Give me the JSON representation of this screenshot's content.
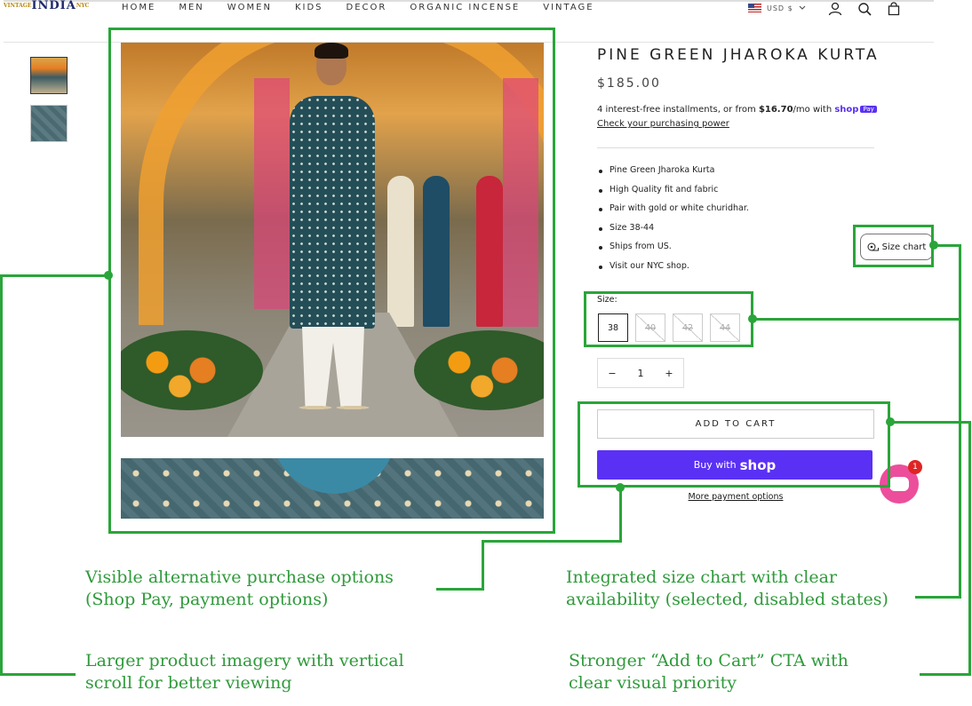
{
  "header": {
    "logo_text": "INDIA",
    "logo_small_left": "VINTAGE",
    "logo_small_right": "NYC",
    "nav": [
      "HOME",
      "MEN",
      "WOMEN",
      "KIDS",
      "DECOR",
      "ORGANIC INCENSE",
      "VINTAGE"
    ],
    "currency": "USD $",
    "icons": [
      "account-icon",
      "search-icon",
      "cart-icon"
    ]
  },
  "product": {
    "title": "PINE GREEN JHAROKA KURTA",
    "price": "$185.00",
    "installments_pre": "4 interest-free installments, or from",
    "installments_amount": "$16.70",
    "installments_post": "/mo with",
    "shop_pay_word": "shop",
    "shop_pay_badge": "Pay",
    "check_power": "Check your purchasing power",
    "bullets": [
      "Pine Green Jharoka Kurta",
      "High Quality fit and fabric",
      "Pair with gold or white churidhar.",
      "Size 38-44",
      "Ships from US.",
      "Visit our NYC shop."
    ],
    "size_chart": "Size chart",
    "size_label": "Size:",
    "sizes": [
      {
        "label": "38",
        "selected": true,
        "available": true
      },
      {
        "label": "40",
        "selected": false,
        "available": false
      },
      {
        "label": "42",
        "selected": false,
        "available": false
      },
      {
        "label": "44",
        "selected": false,
        "available": false
      }
    ],
    "qty_minus": "−",
    "qty_value": "1",
    "qty_plus": "+",
    "add_to_cart": "ADD TO CART",
    "buy_with": "Buy with",
    "shop_word": "shop",
    "more_options": "More payment options",
    "chat_badge": "1"
  },
  "annotations": {
    "purchase_options": [
      "Visible alternative purchase options",
      "(Shop Pay, payment options)"
    ],
    "size_chart": [
      "Integrated size chart with clear",
      "availability (selected, disabled states)"
    ],
    "imagery": [
      "Larger product imagery with vertical",
      "scroll for better viewing"
    ],
    "cta": [
      "Stronger “Add to Cart” CTA with",
      "clear visual priority"
    ]
  },
  "colors": {
    "annotation_green": "#2aa53a",
    "shop_pay_purple": "#5a31f4",
    "chat_pink": "#ec4e9c"
  }
}
